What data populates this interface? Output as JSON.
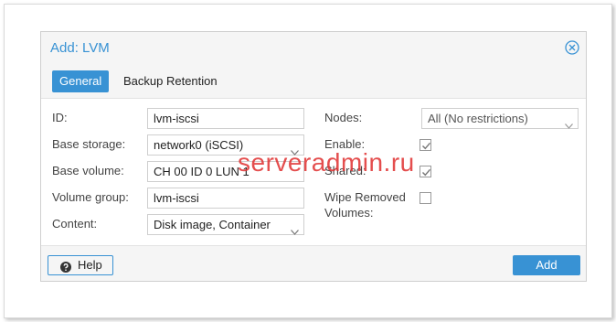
{
  "dialog": {
    "title": "Add: LVM",
    "tabs": [
      {
        "label": "General",
        "active": true
      },
      {
        "label": "Backup Retention",
        "active": false
      }
    ],
    "left": {
      "id_label": "ID:",
      "id_value": "lvm-iscsi",
      "base_storage_label": "Base storage:",
      "base_storage_value": "network0 (iSCSI)",
      "base_volume_label": "Base volume:",
      "base_volume_value": "CH 00 ID 0 LUN 1",
      "volume_group_label": "Volume group:",
      "volume_group_value": "lvm-iscsi",
      "content_label": "Content:",
      "content_value": "Disk image, Container"
    },
    "right": {
      "nodes_label": "Nodes:",
      "nodes_value": "All (No restrictions)",
      "enable_label": "Enable:",
      "enable_checked": true,
      "shared_label": "Shared:",
      "shared_checked": true,
      "wipe_label_line1": "Wipe Removed",
      "wipe_label_line2": "Volumes:",
      "wipe_checked": false
    },
    "footer": {
      "help_label": "Help",
      "add_label": "Add"
    },
    "watermark": "serveradmin.ru",
    "colors": {
      "accent": "#3892d4",
      "watermark": "#e03030"
    }
  }
}
